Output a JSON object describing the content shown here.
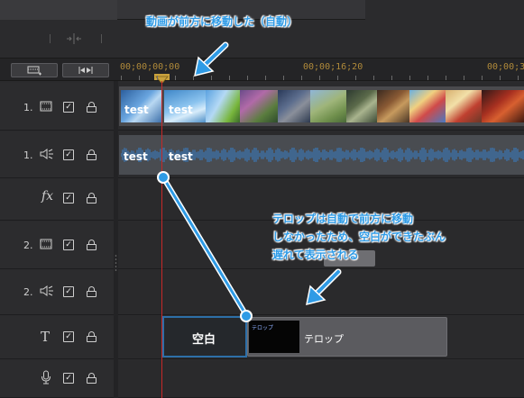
{
  "annotation_top": "動画が前方に移動した（自動）",
  "annotation_mid_line1": "テロップは自動で前方に移動",
  "annotation_mid_line2": "しなかったため、空白ができたぶん",
  "annotation_mid_line3": "遅れて表示される",
  "gap_label": "空白",
  "caption_clip_label": "テロップ",
  "timecodes": [
    "00;00;00;00",
    "00;00;16;20",
    "00;00;3"
  ],
  "video_clip_labels": [
    "test",
    "test"
  ],
  "audio_clip_labels": [
    "test",
    "test"
  ],
  "tracks": [
    {
      "number": "1.",
      "icon": "video-track-icon"
    },
    {
      "number": "1.",
      "icon": "audio-track-icon"
    },
    {
      "number": "",
      "icon": "fx-icon",
      "icon_text": "fx"
    },
    {
      "number": "2.",
      "icon": "video-track-icon"
    },
    {
      "number": "2.",
      "icon": "audio-track-icon"
    },
    {
      "number": "",
      "icon": "title-track-icon",
      "icon_text": "T"
    },
    {
      "number": "",
      "icon": "microphone-icon"
    }
  ],
  "colors": {
    "annotation": "#2f9be6",
    "playhead": "#c62828",
    "timecode": "#b08a3a",
    "gap_border": "#2d6fa8"
  }
}
